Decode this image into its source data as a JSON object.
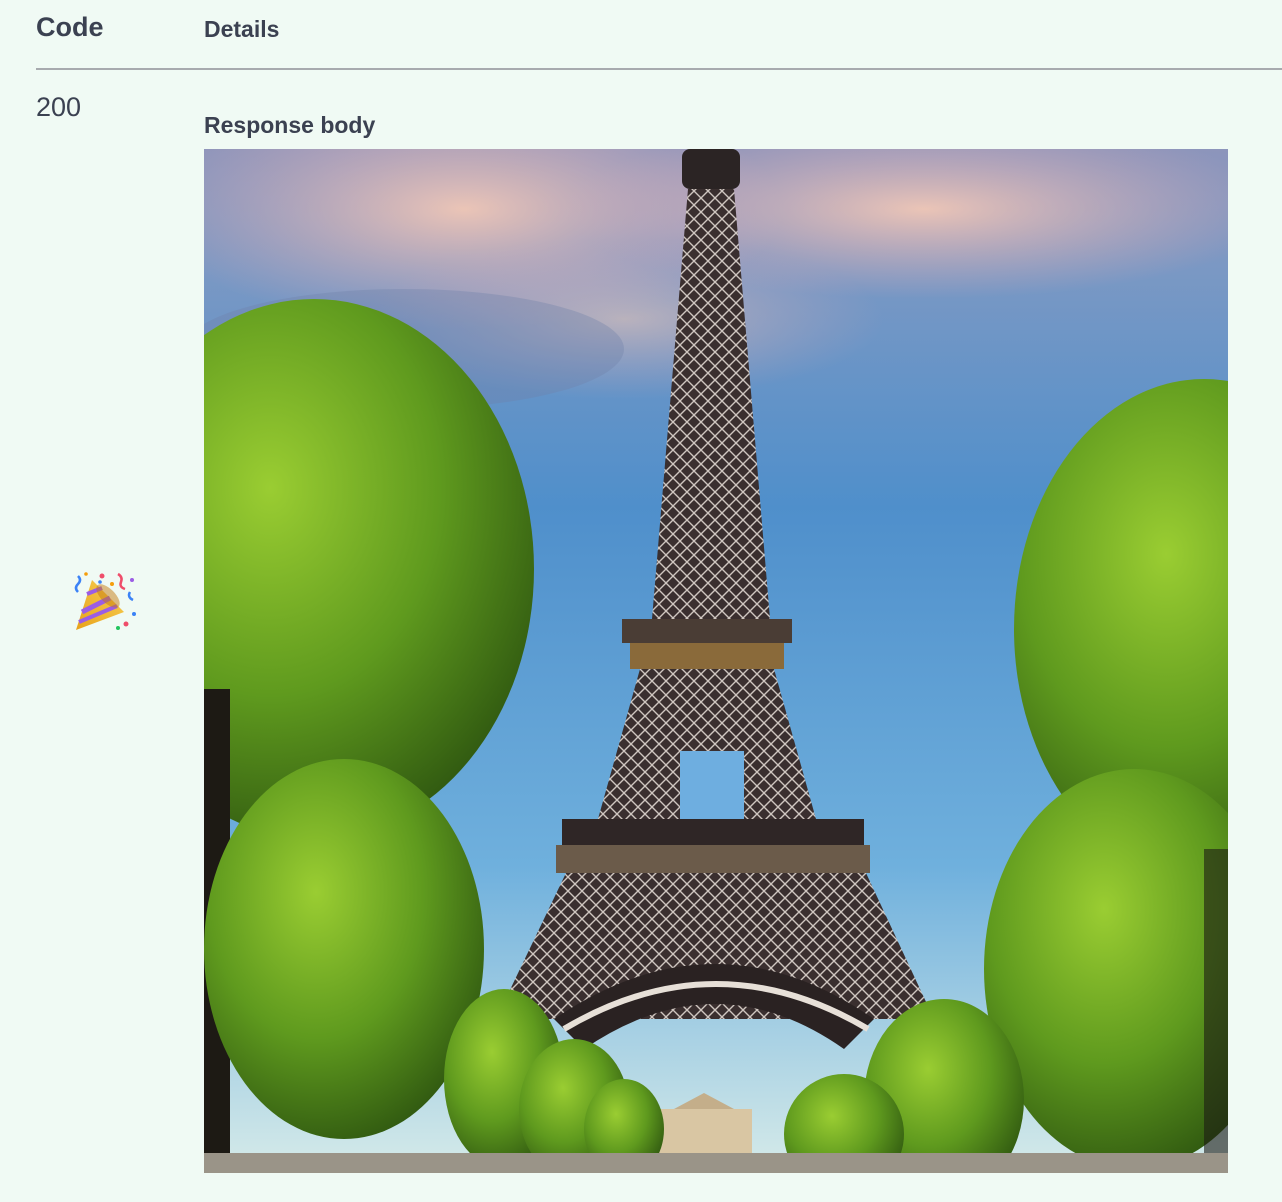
{
  "table": {
    "code_header": "Code",
    "details_header": "Details"
  },
  "response": {
    "status_code": "200",
    "body_label": "Response body",
    "icon": "party-popper-icon"
  },
  "colors": {
    "page_background": "#f0faf4",
    "text": "#3b4151",
    "divider": "#a7aaae"
  }
}
